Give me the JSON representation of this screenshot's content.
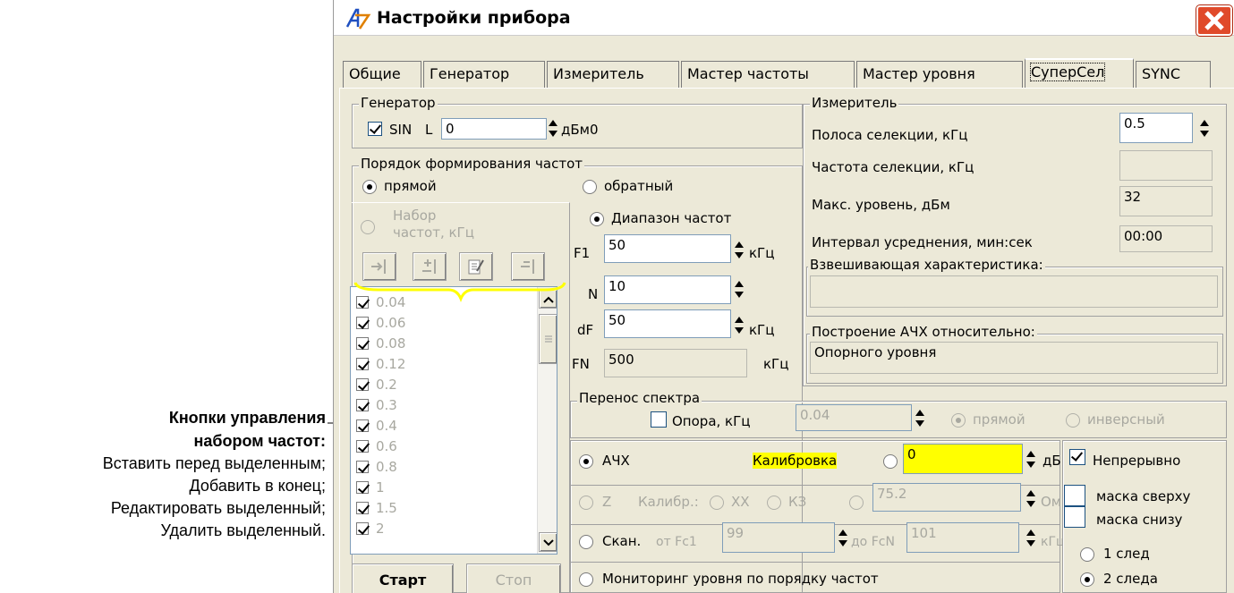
{
  "window": {
    "title": "Настройки прибора"
  },
  "tabs": [
    "Общие",
    "Генератор",
    "Измеритель",
    "Мастер частоты",
    "Мастер уровня",
    "СуперСел",
    "SYNC"
  ],
  "generator": {
    "label": "Генератор",
    "sin": "SIN",
    "l": "L",
    "value": "0",
    "unit": "дБм0"
  },
  "order": {
    "label": "Порядок формирования частот",
    "direct": "прямой",
    "reverse": "обратный"
  },
  "freqset": {
    "label1": "Набор",
    "label2": "частот, кГц",
    "items": [
      "0.04",
      "0.06",
      "0.08",
      "0.12",
      "0.2",
      "0.3",
      "0.4",
      "0.6",
      "0.8",
      "1",
      "1.5",
      "2"
    ]
  },
  "range": {
    "label": "Диапазон частот",
    "f1": "F1",
    "f1v": "50",
    "n": "N",
    "nv": "10",
    "df": "dF",
    "dfv": "50",
    "fn": "FN",
    "fnv": "500",
    "unit": "кГц"
  },
  "meter": {
    "label": "Измеритель",
    "bw": "Полоса селекции, кГц",
    "bwv": "0.5",
    "freq": "Частота селекции, кГц",
    "freqv": "",
    "max": "Макс. уровень, дБм",
    "maxv": "32",
    "avg": "Интервал усреднения, мин:сек",
    "avgv": "00:00",
    "weight": "Взвешивающая характеристика:",
    "weightv": "",
    "build": "Построение АЧХ относительно:",
    "buildv": "Опорного уровня"
  },
  "transfer": {
    "label": "Перенос спектра",
    "ref": "Опора, кГц",
    "refv": "0.04",
    "direct": "прямой",
    "inverse": "инверсный"
  },
  "modes": {
    "afc": "АЧХ",
    "calib": "Калибровка",
    "calibv": "0",
    "db": "дБ",
    "z": "Z",
    "calib2": "Калибр.:",
    "xx": "ХХ",
    "kz": "КЗ",
    "zv": "75.2",
    "ohm": "Ом",
    "scan": "Скан.",
    "from": "от Fc1",
    "fromv": "99",
    "to": "до FcN",
    "tov": "101",
    "khz": "кГц",
    "monitor": "Мониторинг уровня по порядку частот"
  },
  "options": {
    "cont": "Непрерывно",
    "top": "маска сверху",
    "bottom": "маска снизу",
    "one": "1 след",
    "two": "2 следа"
  },
  "buttons": {
    "start": "Старт",
    "stop": "Стоп"
  },
  "annotation": {
    "title1": "Кнопки управления",
    "title2": "набором частот:",
    "l1": "Вставить перед выделенным;",
    "l2": "Добавить в конец;",
    "l3": "Редактировать выделенный;",
    "l4": "Удалить выделенный."
  },
  "colors": {
    "highlight": "#ffff00",
    "bracket": "#ffff00"
  }
}
